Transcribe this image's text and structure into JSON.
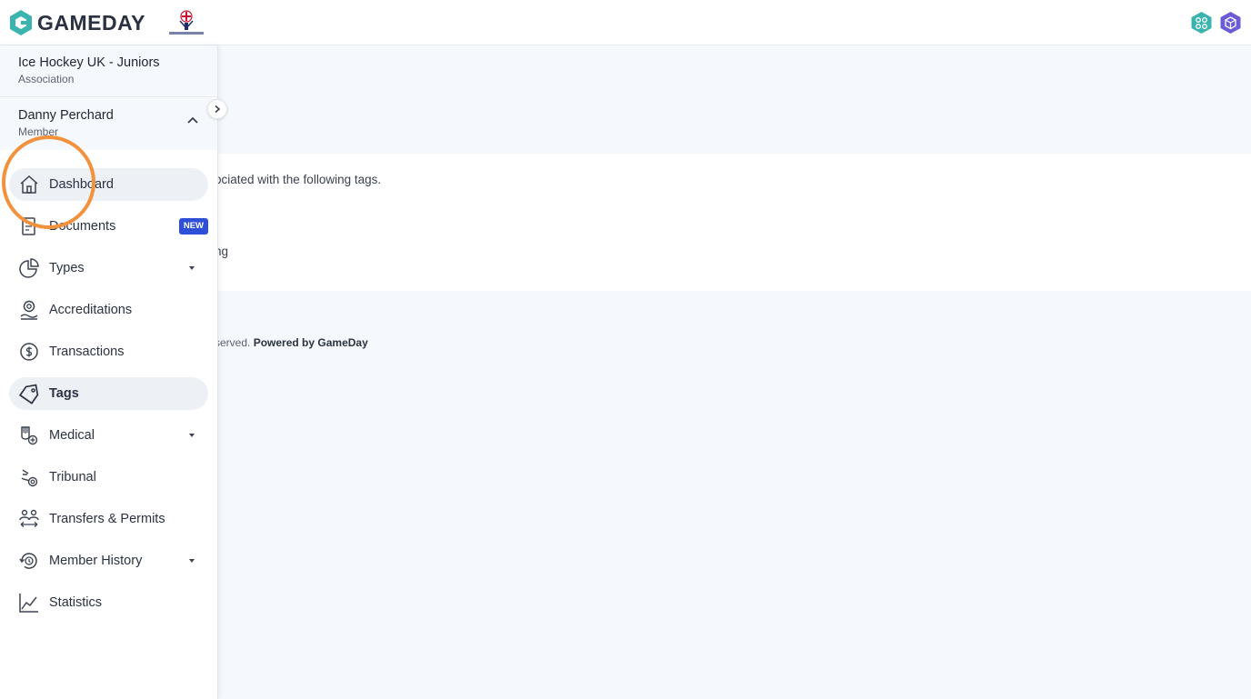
{
  "header": {
    "brand": "GAMEDAY",
    "brand_color": "#3bb4b0",
    "association_logo": "ice-hockey-uk-logo",
    "right_icons": [
      "hex-network-icon",
      "hex-box-icon"
    ]
  },
  "sidebar": {
    "org": {
      "name": "Ice Hockey UK - Juniors",
      "type": "Association"
    },
    "member": {
      "name": "Danny Perchard",
      "type": "Member"
    },
    "items": [
      {
        "label": "Dashboard",
        "icon": "home-icon",
        "active": true
      },
      {
        "label": "Documents",
        "icon": "document-icon",
        "badge": "NEW"
      },
      {
        "label": "Types",
        "icon": "pie-chart-icon",
        "dropdown": true
      },
      {
        "label": "Accreditations",
        "icon": "accreditation-icon"
      },
      {
        "label": "Transactions",
        "icon": "dollar-icon"
      },
      {
        "label": "Tags",
        "icon": "tag-icon",
        "active": true
      },
      {
        "label": "Medical",
        "icon": "medical-icon",
        "dropdown": true
      },
      {
        "label": "Tribunal",
        "icon": "tribunal-icon"
      },
      {
        "label": "Transfers & Permits",
        "icon": "transfer-icon"
      },
      {
        "label": "Member History",
        "icon": "history-icon",
        "dropdown": true
      },
      {
        "label": "Statistics",
        "icon": "statistics-icon"
      }
    ]
  },
  "main": {
    "text_1": "ociated with the following tags.",
    "text_2": "ng",
    "footer_prefix": "served.",
    "footer_powered": "Powered by GameDay"
  },
  "colors": {
    "accent": "#3bb4b0",
    "badge": "#2f4fd8",
    "highlight": "#f2923c",
    "active_bg": "#edf0f5"
  }
}
